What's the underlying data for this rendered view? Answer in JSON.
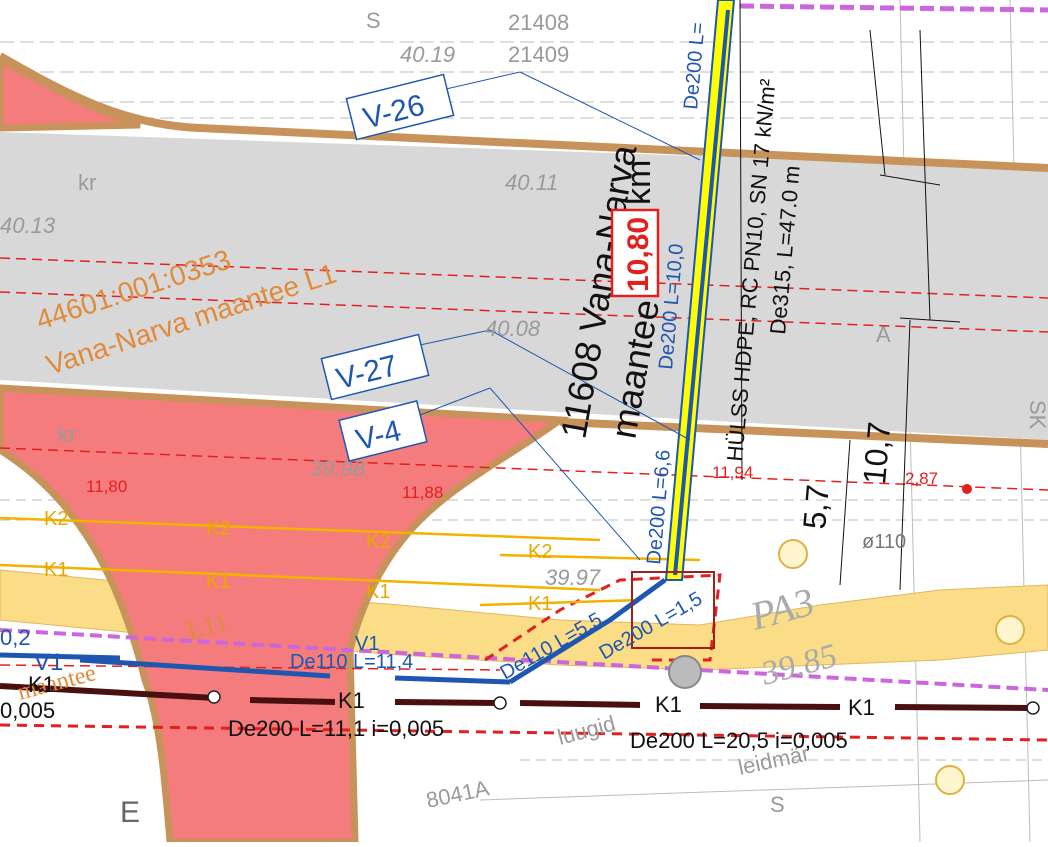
{
  "colors": {
    "road": "#d8d8d8",
    "red_zone": "#f47c7c",
    "edge": "#c8935a",
    "yellow_zone": "#fbdd87",
    "pipe_blue": "#1f57b0",
    "pipe_yellow": "#ffff00",
    "cable_k": "#f2b200",
    "sewer_k1": "#4a1010",
    "dashed_red": "#e32020",
    "property": "#cc66dd",
    "parcel_text": "#e08a3c"
  },
  "labels": {
    "n21408": "21408",
    "n21409": "21409",
    "e4019": "40.19",
    "e4011": "40.11",
    "e4013": "40.13",
    "e4008": "40.08",
    "e3998": "39.98",
    "e3997": "39.97",
    "kr1": "kr",
    "kr2": "kr",
    "A": "A",
    "S_top": "S",
    "S_bottom": "S",
    "E": "E",
    "SK": "SK",
    "parcel_id": "44601:001:0353",
    "parcel_name": "Vana-Narva maantee L1",
    "v26": "V-26",
    "v27": "V-27",
    "v4": "V-4",
    "road_name_a": "11608 Vana-Narva",
    "road_name_b": "maantee",
    "km_value": "10,80",
    "km_unit": "km",
    "pipe_de200_top": "De200 L=",
    "pipe_de200_100": "De200 L=10,0",
    "pipe_de200_66": "De200 L=6,6",
    "pipe_de200_15": "De200 L=1,5",
    "hulss1": "HÜLSS HDPE, RC PN10, SN 17 kN/m²",
    "hulss2": "De315, L=47.0 m",
    "dim_107": "10,7",
    "dim_57": "5,7",
    "dim_1180": "11,80",
    "dim_1188": "11,88",
    "dim_1194": "11,94",
    "dim_287": "2,87",
    "d110": "ø110",
    "k2a": "K2",
    "k2b": "K2",
    "k2c": "K2",
    "k2d": "K2",
    "k1a": "K1",
    "k1b": "K1",
    "k1c": "K1",
    "k1d": "K1",
    "v1": "V1",
    "v1b": "V1",
    "v02": "0,2",
    "de110_114": "De110 L=11,4",
    "de110_55": "De110 L=5,5",
    "de200_15b": "De200 L=1,5",
    "sk1_left": "K1",
    "sk1_mid": "K1",
    "sk1_r1": "K1",
    "sk1_r2": "K1",
    "slope_left": "0,005",
    "de200_111": "De200 L=11,1 i=0,005",
    "de200_205": "De200 L=20,5 i=0,005",
    "pa3": "PA3",
    "e3985": "39.85",
    "n8041a": "8041A",
    "luugi": "luugid",
    "leidm": "leidmär",
    "L11": "L11",
    "maantee_l": "maantee"
  }
}
